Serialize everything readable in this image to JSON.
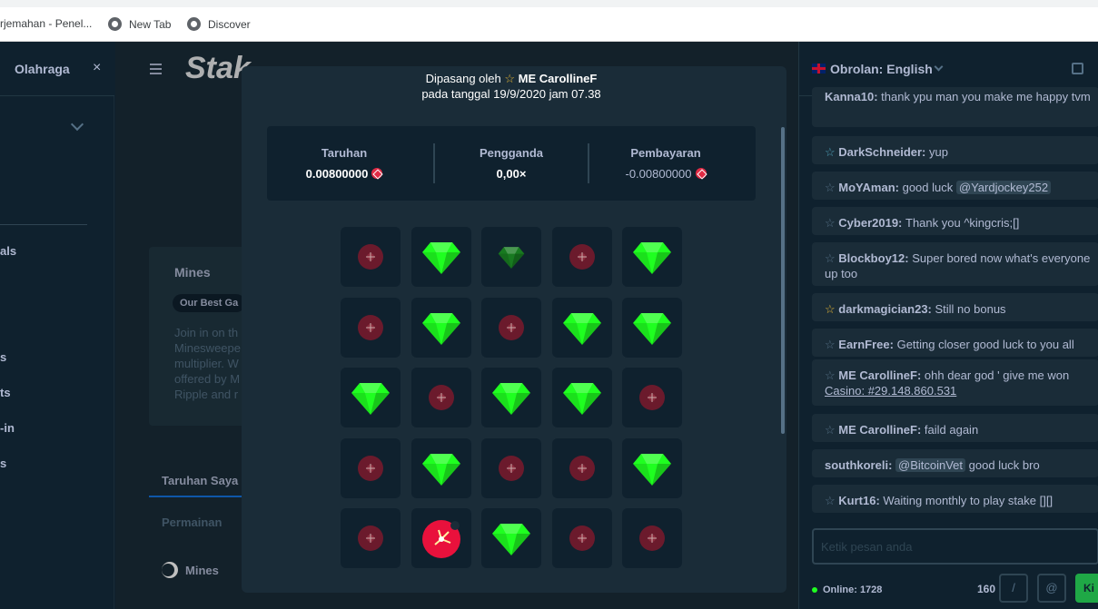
{
  "browser": {
    "bookmarks": [
      {
        "label": "rjemahan - Penel..."
      },
      {
        "label": "New Tab"
      },
      {
        "label": "Discover"
      }
    ]
  },
  "sidebar": {
    "header": "Olahraga",
    "items": [
      "als",
      "s",
      "ts",
      "-in",
      "s"
    ]
  },
  "main": {
    "card_title": "Mines",
    "card_pill": "Our Best Ga",
    "card_desc": [
      "Join in on th",
      "Minesweepe",
      "multiplier. W",
      "offered by M",
      "Ripple and r"
    ],
    "tab_label": "Taruhan Saya",
    "section_label": "Permainan",
    "game_name": "Mines"
  },
  "modal": {
    "placed_prefix": "Dipasang oleh",
    "placed_user": "ME CarollineF",
    "placed_date": "pada tanggal 19/9/2020 jam 07.38",
    "stats": [
      {
        "label": "Taruhan",
        "value": "0.00800000"
      },
      {
        "label": "Pengganda",
        "value": "0,00×"
      },
      {
        "label": "Pembayaran",
        "value": "-0.00800000"
      }
    ],
    "grid": [
      [
        "mine",
        "gem",
        "gem-dim",
        "mine",
        "gem"
      ],
      [
        "mine",
        "gem",
        "mine",
        "gem",
        "gem"
      ],
      [
        "gem",
        "mine",
        "gem",
        "gem",
        "mine"
      ],
      [
        "mine",
        "gem",
        "mine",
        "mine",
        "gem"
      ],
      [
        "mine",
        "mine-hit",
        "gem",
        "mine",
        "mine"
      ]
    ],
    "colors": {
      "gem": "#1fff20",
      "mine": "#6b1a2c",
      "mine_hit": "#e9113c"
    }
  },
  "chat": {
    "title": "Obrolan:",
    "language": "English",
    "messages": [
      {
        "user": "Kanna10:",
        "text": "thank ypu man you make me happy tvm",
        "star": "none"
      },
      {
        "user": "DarkSchneider:",
        "text": "yup",
        "star": "blue"
      },
      {
        "user": "MoYAman:",
        "text": "good luck",
        "tag": "@Yardjockey252",
        "star": "grey"
      },
      {
        "user": "Cyber2019:",
        "text": "Thank you ^kingcris;[]",
        "star": "grey"
      },
      {
        "user": "Blockboy12:",
        "text": "Super bored now what's everyone up too",
        "star": "grey"
      },
      {
        "user": "darkmagician23:",
        "text": "Still no bonus",
        "star": "gold"
      },
      {
        "user": "EarnFree:",
        "text": "Getting closer good luck to you all",
        "star": "grey"
      },
      {
        "user": "ME CarollineF:",
        "text": "ohh dear god ' give me won",
        "link": "Casino: #29.148.860.531",
        "star": "grey"
      },
      {
        "user": "ME CarollineF:",
        "text": "faild again",
        "star": "grey"
      },
      {
        "user": "southkoreli:",
        "tag": "@BitcoinVet",
        "text": "good luck bro",
        "star": "none"
      },
      {
        "user": "Kurt16:",
        "text": "Waiting monthly to play stake [][]",
        "star": "grey"
      }
    ],
    "input_placeholder": "Ketik pesan anda",
    "online_label": "Online: 1728",
    "char_count": "160",
    "slash_button": "/",
    "at_button": "@",
    "send_label": "Ki"
  }
}
